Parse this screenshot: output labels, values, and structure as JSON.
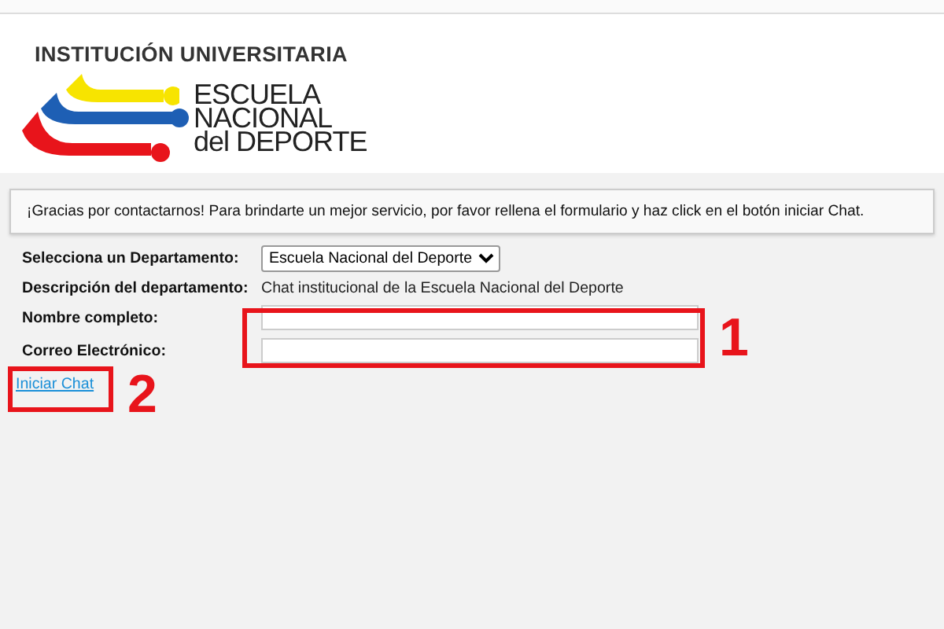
{
  "logo": {
    "top_line": "INSTITUCIÓN UNIVERSITARIA",
    "lines": [
      "ESCUELA",
      "NACIONAL",
      "del DEPORTE"
    ]
  },
  "message": "¡Gracias por contactarnos! Para brindarte un mejor servicio, por favor rellena el formulario y haz click en el botón iniciar Chat.",
  "form": {
    "department": {
      "label": "Selecciona un Departamento:",
      "value": "Escuela Nacional del Deporte"
    },
    "description": {
      "label": "Descripción del departamento:",
      "value": "Chat institucional de la Escuela Nacional del Deporte"
    },
    "fields": [
      {
        "label": "Nombre completo:"
      },
      {
        "label": "Correo Electrónico:"
      }
    ],
    "link": "Iniciar Chat"
  },
  "annotations": [
    {
      "label": "1"
    },
    {
      "label": "2"
    }
  ]
}
